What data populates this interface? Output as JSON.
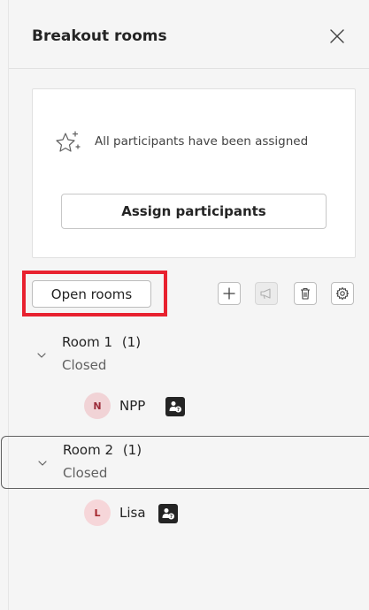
{
  "panel": {
    "title": "Breakout rooms"
  },
  "status_card": {
    "message": "All participants have been assigned",
    "assign_button_label": "Assign participants"
  },
  "toolbar": {
    "open_rooms_label": "Open rooms",
    "tools": [
      {
        "icon": "plus-icon"
      },
      {
        "icon": "announcement-icon",
        "disabled": true
      },
      {
        "icon": "trash-icon"
      },
      {
        "icon": "gear-icon"
      }
    ]
  },
  "rooms": [
    {
      "name": "Room 1",
      "count": "(1)",
      "status": "Closed",
      "participant": {
        "initial": "N",
        "name": "NPP",
        "avatar_bg": "#f1d3d6",
        "avatar_fg": "#9b2c3a"
      }
    },
    {
      "name": "Room 2",
      "count": "(1)",
      "status": "Closed",
      "participant": {
        "initial": "L",
        "name": "Lisa",
        "avatar_bg": "#f6d6d9",
        "avatar_fg": "#a4262c"
      }
    }
  ],
  "colors": {
    "highlight": "#e8212f",
    "panel_bg": "#f5f5f5",
    "card_bg": "#ffffff"
  }
}
